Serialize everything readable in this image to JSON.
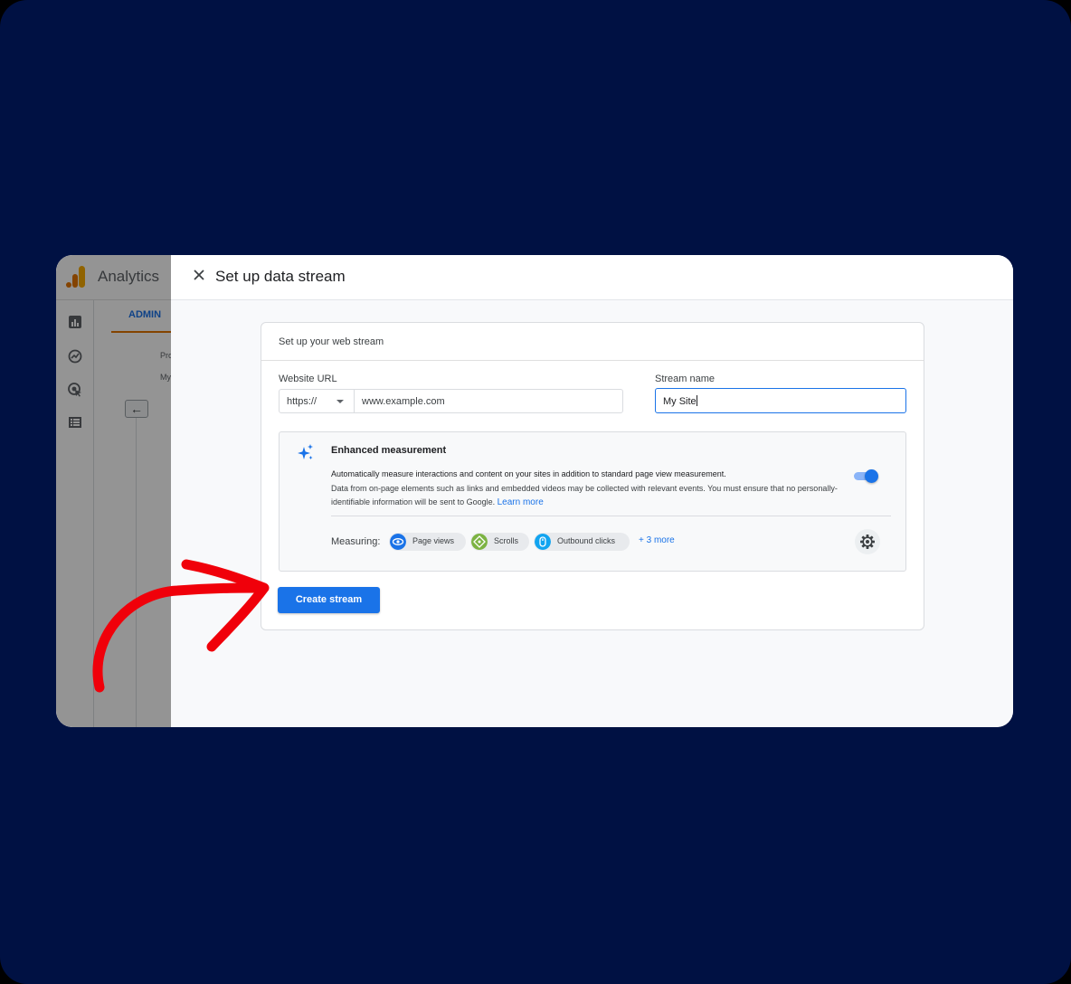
{
  "app": {
    "name": "Analytics",
    "admin_tab": "ADMIN",
    "snippets": [
      "Pro",
      "My"
    ]
  },
  "dialog": {
    "title": "Set up data stream",
    "card_heading": "Set up your web stream",
    "website_url_label": "Website URL",
    "protocol_value": "https://",
    "url_placeholder": "www.example.com",
    "stream_name_label": "Stream name",
    "stream_name_value": "My Site",
    "enhanced": {
      "title": "Enhanced measurement",
      "description_1": "Automatically measure interactions and content on your sites in addition to standard page view measurement.",
      "description_2": "Data from on-page elements such as links and embedded videos may be collected with relevant events. You must ensure that no personally-identifiable information will be sent to Google.",
      "learn_more": "Learn more",
      "toggle_on": true,
      "measuring_label": "Measuring:",
      "chips": [
        {
          "label": "Page views",
          "icon": "eye-icon",
          "color": "#1a73e8"
        },
        {
          "label": "Scrolls",
          "icon": "crosshair-icon",
          "color": "#7cb342"
        },
        {
          "label": "Outbound clicks",
          "icon": "mouse-icon",
          "color": "#12a4f0"
        }
      ],
      "more_link": "+ 3 more"
    },
    "create_button": "Create stream"
  },
  "colors": {
    "background": "#001143",
    "accent": "#1a73e8",
    "annotation_arrow": "#f0000a"
  }
}
